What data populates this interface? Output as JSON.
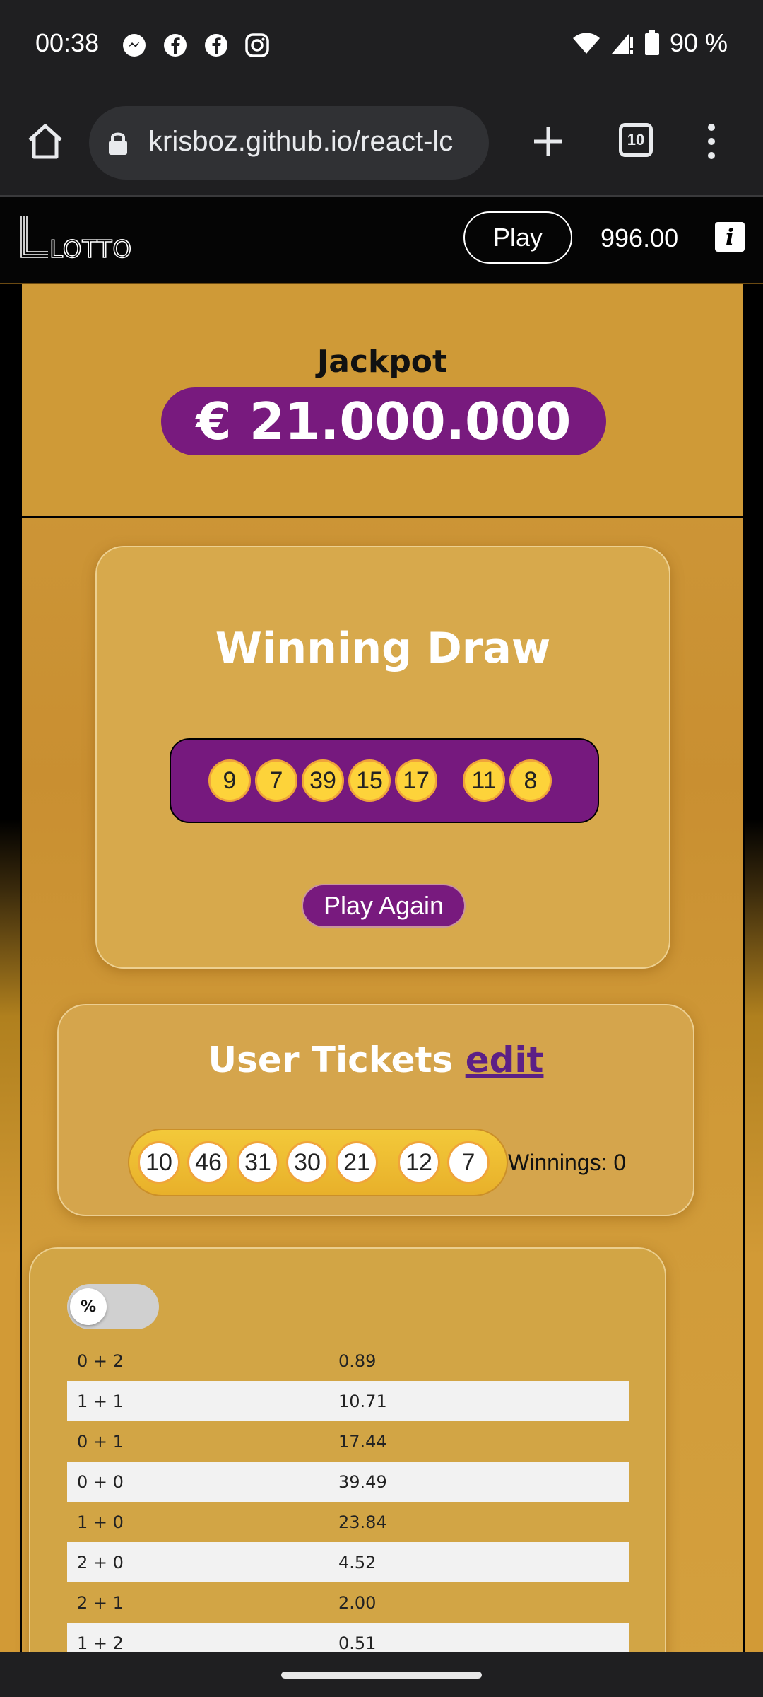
{
  "status_bar": {
    "time": "00:38",
    "battery": "90 %",
    "notification_icons": [
      "messenger-icon",
      "facebook-icon",
      "facebook-icon",
      "instagram-icon"
    ]
  },
  "browser": {
    "url": "krisboz.github.io/react-lc",
    "tab_count": "10"
  },
  "header": {
    "logo_text": "LOTTO",
    "play_label": "Play",
    "balance": "996.00",
    "info_label": "i"
  },
  "jackpot": {
    "label": "Jackpot",
    "amount": "€ 21.000.000"
  },
  "winning_draw": {
    "title": "Winning Draw",
    "main_numbers": [
      "9",
      "7",
      "39",
      "15",
      "17"
    ],
    "extra_numbers": [
      "11",
      "8"
    ],
    "play_again_label": "Play Again"
  },
  "user_tickets": {
    "title": "User Tickets",
    "edit_label": "edit",
    "main_numbers": [
      "10",
      "46",
      "31",
      "30",
      "21"
    ],
    "extra_numbers": [
      "12",
      "7"
    ],
    "winnings_label": "Winnings: 0"
  },
  "odds": {
    "toggle_label": "%",
    "rows": [
      {
        "combo": "0 + 2",
        "value": "0.89"
      },
      {
        "combo": "1 + 1",
        "value": "10.71"
      },
      {
        "combo": "0 + 1",
        "value": "17.44"
      },
      {
        "combo": "0 + 0",
        "value": "39.49"
      },
      {
        "combo": "1 + 0",
        "value": "23.84"
      },
      {
        "combo": "2 + 0",
        "value": "4.52"
      },
      {
        "combo": "2 + 1",
        "value": "2.00"
      },
      {
        "combo": "1 + 2",
        "value": "0.51"
      }
    ]
  },
  "colors": {
    "accent_purple": "#781a7e",
    "gold": "#cf9a37",
    "ball_yellow": "#fdd33a"
  }
}
